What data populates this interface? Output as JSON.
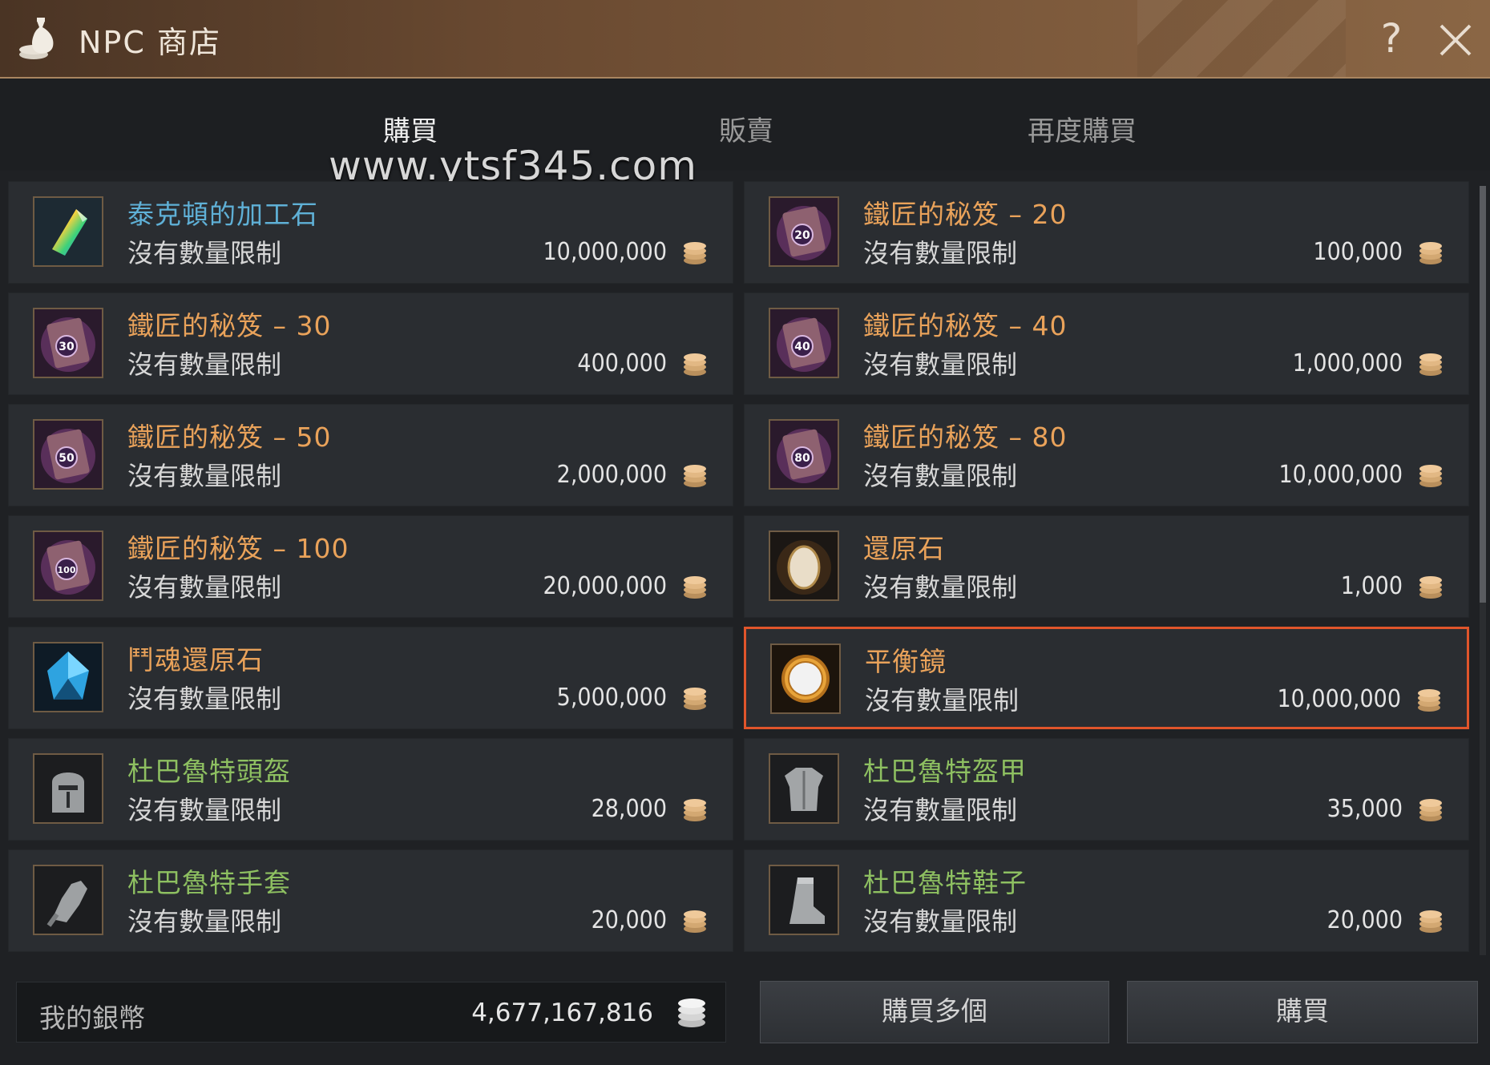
{
  "window": {
    "title": "NPC 商店",
    "help_label": "?",
    "close_label": "✕"
  },
  "tabs": [
    {
      "label": "購買",
      "active": true
    },
    {
      "label": "販賣",
      "active": false
    },
    {
      "label": "再度購買",
      "active": false
    }
  ],
  "watermark": "www.ytsf345.com",
  "items": [
    {
      "name": "泰克頓的加工石",
      "limit": "沒有數量限制",
      "price": "10,000,000",
      "color": "#5fb0d6",
      "icon": "rainbow-gem-icon",
      "selected": false
    },
    {
      "name": "鐵匠的秘笈 – 20",
      "limit": "沒有數量限制",
      "price": "100,000",
      "color": "#e9a25a",
      "icon": "book-icon",
      "badge": "20",
      "selected": false
    },
    {
      "name": "鐵匠的秘笈 – 30",
      "limit": "沒有數量限制",
      "price": "400,000",
      "color": "#e9a25a",
      "icon": "book-icon",
      "badge": "30",
      "selected": false
    },
    {
      "name": "鐵匠的秘笈 – 40",
      "limit": "沒有數量限制",
      "price": "1,000,000",
      "color": "#e9a25a",
      "icon": "book-icon",
      "badge": "40",
      "selected": false
    },
    {
      "name": "鐵匠的秘笈 – 50",
      "limit": "沒有數量限制",
      "price": "2,000,000",
      "color": "#e9a25a",
      "icon": "book-icon",
      "badge": "50",
      "selected": false
    },
    {
      "name": "鐵匠的秘笈 – 80",
      "limit": "沒有數量限制",
      "price": "10,000,000",
      "color": "#e9a25a",
      "icon": "book-icon",
      "badge": "80",
      "selected": false
    },
    {
      "name": "鐵匠的秘笈 – 100",
      "limit": "沒有數量限制",
      "price": "20,000,000",
      "color": "#e9a25a",
      "icon": "book-icon",
      "badge": "100",
      "selected": false
    },
    {
      "name": "還原石",
      "limit": "沒有數量限制",
      "price": "1,000",
      "color": "#e9a25a",
      "icon": "restoration-stone-icon",
      "selected": false
    },
    {
      "name": "鬥魂還原石",
      "limit": "沒有數量限制",
      "price": "5,000,000",
      "color": "#e9a25a",
      "icon": "blue-crystal-icon",
      "selected": false
    },
    {
      "name": "平衡鏡",
      "limit": "沒有數量限制",
      "price": "10,000,000",
      "color": "#e9a25a",
      "icon": "mirror-icon",
      "selected": true
    },
    {
      "name": "杜巴魯特頭盔",
      "limit": "沒有數量限制",
      "price": "28,000",
      "color": "#8ec061",
      "icon": "helmet-icon",
      "selected": false
    },
    {
      "name": "杜巴魯特盔甲",
      "limit": "沒有數量限制",
      "price": "35,000",
      "color": "#8ec061",
      "icon": "armor-icon",
      "selected": false
    },
    {
      "name": "杜巴魯特手套",
      "limit": "沒有數量限制",
      "price": "20,000",
      "color": "#8ec061",
      "icon": "gloves-icon",
      "selected": false
    },
    {
      "name": "杜巴魯特鞋子",
      "limit": "沒有數量限制",
      "price": "20,000",
      "color": "#8ec061",
      "icon": "boots-icon",
      "selected": false
    }
  ],
  "wallet": {
    "label": "我的銀幣",
    "amount": "4,677,167,816"
  },
  "buttons": {
    "buy_multiple": "購買多個",
    "buy": "購買"
  }
}
